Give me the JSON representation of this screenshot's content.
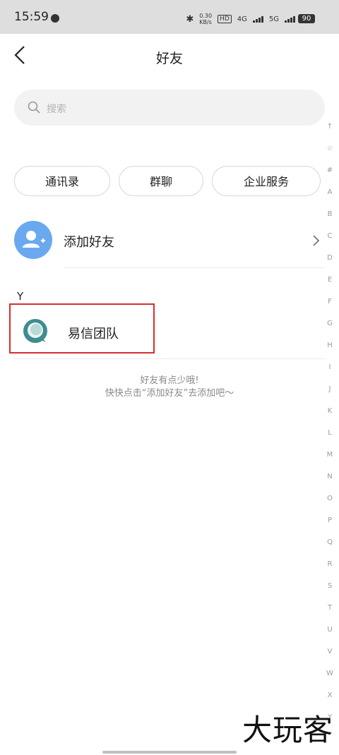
{
  "status_bar": {
    "time": "15:59",
    "speed_value": "0.30",
    "speed_unit": "KB/s",
    "hd": "HD",
    "net1": "4G",
    "net2": "5G",
    "battery": "90"
  },
  "header": {
    "title": "好友"
  },
  "search": {
    "placeholder": "搜索"
  },
  "chips": [
    "通讯录",
    "群聊",
    "企业服务"
  ],
  "add_friend": {
    "label": "添加好友"
  },
  "contacts": {
    "section_letter": "Y",
    "items": [
      {
        "name": "易信团队"
      }
    ]
  },
  "empty_state": {
    "line1": "好友有点少哦!",
    "line2": "快快点击“添加好友”去添加吧～"
  },
  "index_letters": [
    "↑",
    "☆",
    "#",
    "A",
    "B",
    "C",
    "D",
    "E",
    "F",
    "G",
    "H",
    "I",
    "J",
    "K",
    "L",
    "M",
    "N",
    "O",
    "P",
    "Q",
    "R",
    "S",
    "T",
    "U",
    "V",
    "W",
    "X",
    "Y"
  ],
  "watermark": "大玩客",
  "colors": {
    "accent_avatar": "#6aa9ef",
    "highlight_box": "#d62f2f",
    "team_avatar": "#3f8c8f"
  }
}
